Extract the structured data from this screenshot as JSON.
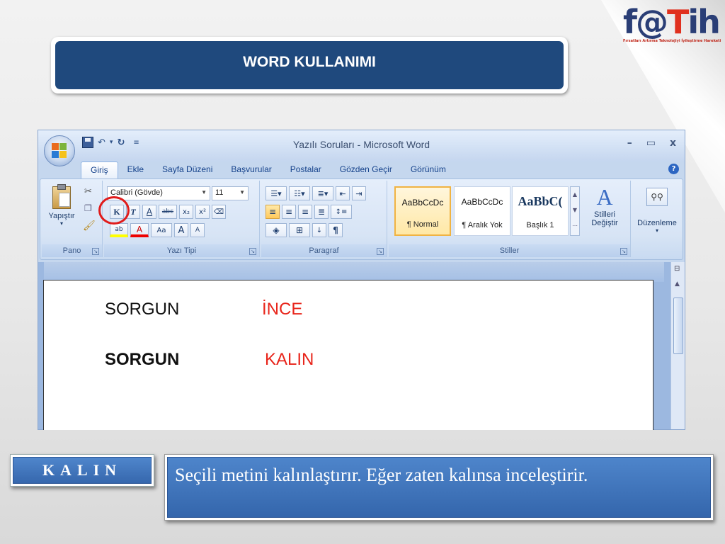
{
  "slide": {
    "title": "WORD KULLANIMI",
    "logo": {
      "text_main": "f@",
      "text_mid": "T",
      "text_end": "ih",
      "tagline": "Fırsatları Artırma Teknolojiyi İyileştirme Hareketi"
    }
  },
  "word": {
    "window_title": "Yazılı Soruları - Microsoft Word",
    "controls": {
      "minimize": "–",
      "maximize": "▭",
      "close": "x"
    },
    "tabs": [
      "Giriş",
      "Ekle",
      "Sayfa Düzeni",
      "Başvurular",
      "Postalar",
      "Gözden Geçir",
      "Görünüm"
    ],
    "ribbon": {
      "clipboard": {
        "paste_label": "Yapıştır",
        "group": "Pano"
      },
      "font": {
        "font_name": "Calibri (Gövde)",
        "font_size": "11",
        "group": "Yazı Tipi",
        "bold": "K",
        "italic": "T",
        "underline": "A",
        "strike": "abc",
        "sub": "x₂",
        "sup": "x²",
        "grow": "A",
        "shrink": "A",
        "case": "Aa"
      },
      "paragraph": {
        "group": "Paragraf",
        "pilcrow": "¶"
      },
      "styles": {
        "group": "Stiller",
        "items": [
          {
            "sample": "AaBbCcDc",
            "name": "¶ Normal"
          },
          {
            "sample": "AaBbCcDc",
            "name": "¶ Aralık Yok"
          },
          {
            "sample": "AaBbC(",
            "name": "Başlık 1"
          }
        ],
        "change_styles_1": "Stilleri",
        "change_styles_2": "Değiştir"
      },
      "editing": {
        "label": "Düzenleme"
      }
    },
    "document": {
      "line1": {
        "word": "SORGUN",
        "label": "İNCE"
      },
      "line2": {
        "word": "SORGUN",
        "label": "KALIN"
      }
    }
  },
  "caption": {
    "term": "KALIN",
    "description": "Seçili metini kalınlaştırır. Eğer zaten kalınsa inceleştirir."
  },
  "colors": {
    "banner": "#1f497d",
    "caption_blue": "#3f74bd",
    "highlight_red": "#e01b1b",
    "doc_red": "#e8251b"
  }
}
